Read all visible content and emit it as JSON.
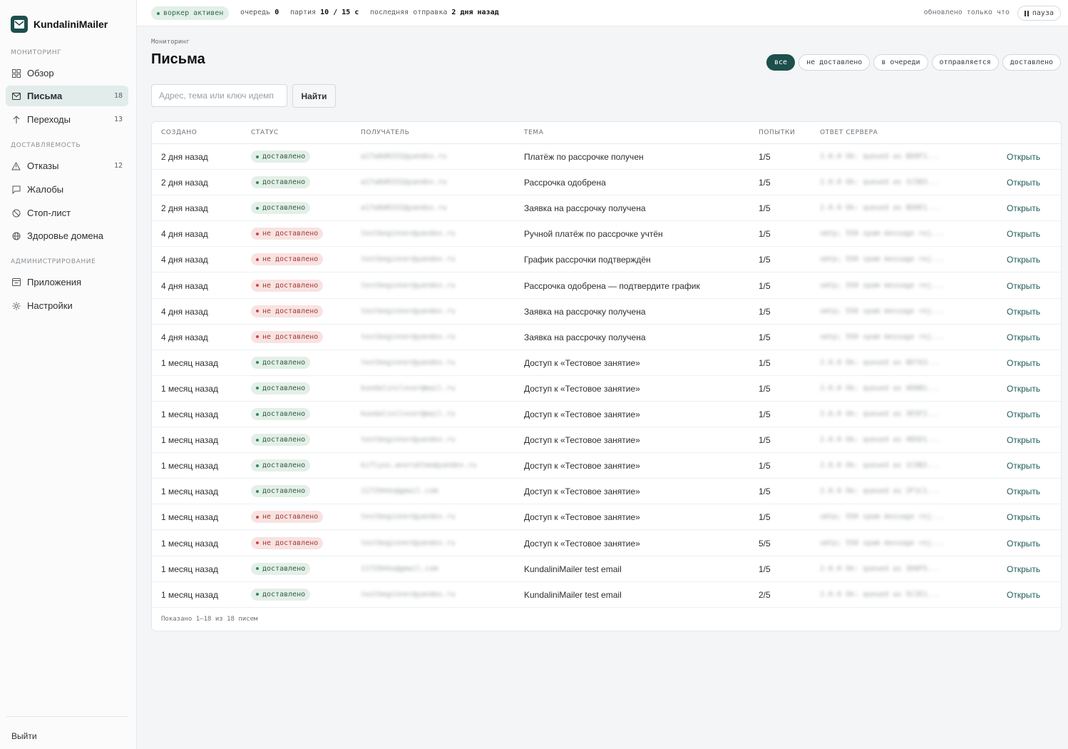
{
  "app": {
    "name": "KundaliniMailer"
  },
  "sidebar": {
    "sections": [
      {
        "title": "МОНИТОРИНГ"
      },
      {
        "title": "ДОСТАВЛЯЕМОСТЬ"
      },
      {
        "title": "АДМИНИСТРИРОВАНИЕ"
      }
    ],
    "items": [
      {
        "label": "Обзор",
        "count": "",
        "icon": "grid-icon"
      },
      {
        "label": "Письма",
        "count": "18",
        "icon": "mail-icon"
      },
      {
        "label": "Переходы",
        "count": "13",
        "icon": "arrow-up-icon"
      },
      {
        "label": "Отказы",
        "count": "12",
        "icon": "warning-icon"
      },
      {
        "label": "Жалобы",
        "count": "",
        "icon": "chat-icon"
      },
      {
        "label": "Стоп-лист",
        "count": "",
        "icon": "ban-icon"
      },
      {
        "label": "Здоровье домена",
        "count": "",
        "icon": "globe-icon"
      },
      {
        "label": "Приложения",
        "count": "",
        "icon": "app-icon"
      },
      {
        "label": "Настройки",
        "count": "",
        "icon": "gear-icon"
      }
    ],
    "logout": "Выйти"
  },
  "topbar": {
    "worker_status": "воркер активен",
    "queue_label": "очередь",
    "queue_value": "0",
    "batch_label": "партия",
    "batch_value": "10 / 15 с",
    "last_send_label": "последняя отправка",
    "last_send_value": "2 дня назад",
    "updated": "обновлено только что",
    "pause": "пауза"
  },
  "page": {
    "breadcrumb": "Мониторинг",
    "title": "Письма",
    "filters": [
      "все",
      "не доставлено",
      "в очереди",
      "отправляется",
      "доставлено"
    ],
    "active_filter": "все",
    "search_placeholder": "Адрес, тема или ключ идемп",
    "search_button": "Найти"
  },
  "table": {
    "columns": [
      "СОЗДАНО",
      "СТАТУС",
      "ПОЛУЧАТЕЛЬ",
      "ТЕМА",
      "ПОПЫТКИ",
      "ОТВЕТ СЕРВЕРА"
    ],
    "open_label": "Открыть",
    "rows": [
      {
        "created": "2 дня назад",
        "status": "доставлено",
        "ok": true,
        "recipient": "a17a8d0332@yandex.ru",
        "subject": "Платёж по рассрочке получен",
        "attempts": "1/5",
        "response": "2.0.0 Ok: queued as 8D0F1..."
      },
      {
        "created": "2 дня назад",
        "status": "доставлено",
        "ok": true,
        "recipient": "a17a8d0332@yandex.ru",
        "subject": "Рассрочка одобрена",
        "attempts": "1/5",
        "response": "2.0.0 Ok: queued as 1C5B3..."
      },
      {
        "created": "2 дня назад",
        "status": "доставлено",
        "ok": true,
        "recipient": "a17a8d0332@yandex.ru",
        "subject": "Заявка на рассрочку получена",
        "attempts": "1/5",
        "response": "2.0.0 Ok: queued as 8D0E1..."
      },
      {
        "created": "4 дня назад",
        "status": "не доставлено",
        "ok": false,
        "recipient": "testbeginner@yandex.ru",
        "subject": "Ручной платёж по рассрочке учтён",
        "attempts": "1/5",
        "response": "smtp; 550 spam message rej..."
      },
      {
        "created": "4 дня назад",
        "status": "не доставлено",
        "ok": false,
        "recipient": "testbeginner@yandex.ru",
        "subject": "График рассрочки подтверждён",
        "attempts": "1/5",
        "response": "smtp; 550 spam message rej..."
      },
      {
        "created": "4 дня назад",
        "status": "не доставлено",
        "ok": false,
        "recipient": "testbeginner@yandex.ru",
        "subject": "Рассрочка одобрена — подтвердите график",
        "attempts": "1/5",
        "response": "smtp; 550 spam message rej..."
      },
      {
        "created": "4 дня назад",
        "status": "не доставлено",
        "ok": false,
        "recipient": "testbeginner@yandex.ru",
        "subject": "Заявка на рассрочку получена",
        "attempts": "1/5",
        "response": "smtp; 550 spam message rej..."
      },
      {
        "created": "4 дня назад",
        "status": "не доставлено",
        "ok": false,
        "recipient": "testbeginner@yandex.ru",
        "subject": "Заявка на рассрочку получена",
        "attempts": "1/5",
        "response": "smtp; 550 spam message rej..."
      },
      {
        "created": "1 месяц назад",
        "status": "доставлено",
        "ok": true,
        "recipient": "testbeginner@yandex.ru",
        "subject": "Доступ к «Тестовое занятие»",
        "attempts": "1/5",
        "response": "2.0.0 Ok: queued as 8D7A3..."
      },
      {
        "created": "1 месяц назад",
        "status": "доставлено",
        "ok": true,
        "recipient": "kundalinilover@mail.ru",
        "subject": "Доступ к «Тестовое занятие»",
        "attempts": "1/5",
        "response": "2.0.0 Ok: queued as 4D0B1..."
      },
      {
        "created": "1 месяц назад",
        "status": "доставлено",
        "ok": true,
        "recipient": "kundalinilover@mail.ru",
        "subject": "Доступ к «Тестовое занятие»",
        "attempts": "1/5",
        "response": "2.0.0 Ok: queued as 3E5F2..."
      },
      {
        "created": "1 месяц назад",
        "status": "доставлено",
        "ok": true,
        "recipient": "testbeginner@yandex.ru",
        "subject": "Доступ к «Тестовое занятие»",
        "attempts": "1/5",
        "response": "2.0.0 Ok: queued as 4B5D1..."
      },
      {
        "created": "1 месяц назад",
        "status": "доставлено",
        "ok": true,
        "recipient": "kiflyus.anoruktmo@yandex.ru",
        "subject": "Доступ к «Тестовое занятие»",
        "attempts": "1/5",
        "response": "2.0.0 Ok: queued as 1C9B2..."
      },
      {
        "created": "1 месяц назад",
        "status": "доставлено",
        "ok": true,
        "recipient": "1172944x@gmail.com",
        "subject": "Доступ к «Тестовое занятие»",
        "attempts": "1/5",
        "response": "2.0.0 Ok: queued as 2F1C1..."
      },
      {
        "created": "1 месяц назад",
        "status": "не доставлено",
        "ok": false,
        "recipient": "testbeginner@yandex.ru",
        "subject": "Доступ к «Тестовое занятие»",
        "attempts": "1/5",
        "response": "smtp; 550 spam message rej..."
      },
      {
        "created": "1 месяц назад",
        "status": "не доставлено",
        "ok": false,
        "recipient": "testbeginner@yandex.ru",
        "subject": "Доступ к «Тестовое занятие»",
        "attempts": "5/5",
        "response": "smtp; 550 spam message rej..."
      },
      {
        "created": "1 месяц назад",
        "status": "доставлено",
        "ok": true,
        "recipient": "1172944x@gmail.com",
        "subject": "KundaliniMailer test email",
        "attempts": "1/5",
        "response": "2.0.0 Ok: queued as 3D8F5..."
      },
      {
        "created": "1 месяц назад",
        "status": "доставлено",
        "ok": true,
        "recipient": "testbeginner@yandex.ru",
        "subject": "KundaliniMailer test email",
        "attempts": "2/5",
        "response": "2.0.0 Ok: queued as 5C2E1..."
      }
    ],
    "footer": "Показано 1–18 из 18 писем"
  },
  "colors": {
    "accent": "#1d4f4c",
    "ok_bg": "#e4efe8",
    "fail_bg": "#f8e3e2",
    "link": "#1d5d5a"
  }
}
